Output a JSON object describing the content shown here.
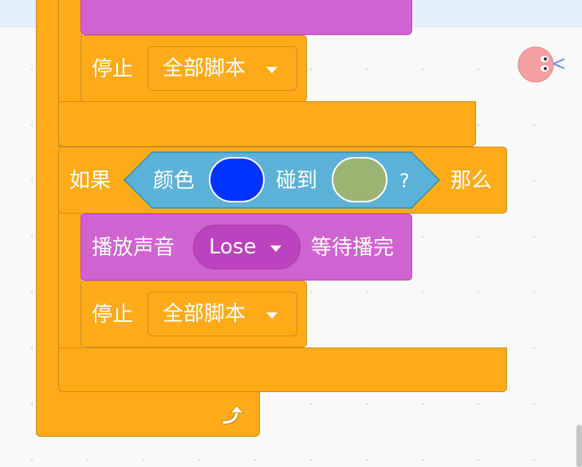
{
  "blocks": {
    "stop_1": {
      "label": "停止",
      "option": "全部脚本"
    },
    "if_block": {
      "if_label": "如果",
      "then_label": "那么"
    },
    "condition": {
      "color_label": "颜色",
      "touch_label": "碰到",
      "question": "?"
    },
    "colors": {
      "color_1": "#0033ff",
      "color_2": "#9bb373"
    },
    "play_sound": {
      "label": "播放声音",
      "sound": "Lose",
      "suffix": "等待播完"
    },
    "stop_2": {
      "label": "停止",
      "option": "全部脚本"
    }
  },
  "sprite": {
    "icon": "sprite-face-icon"
  }
}
